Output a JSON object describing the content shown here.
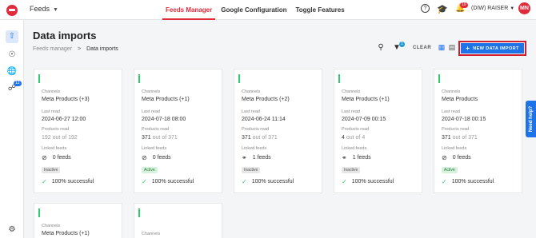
{
  "topbar": {
    "app_label": "Feeds",
    "tabs": [
      "Feeds Manager",
      "Google Configuration",
      "Toggle Features"
    ],
    "active_tab_index": 0,
    "notification_count": "10",
    "account_label": "(DIW) RAISER",
    "avatar_initials": "MN"
  },
  "sidebar": {
    "items": [
      "upload-icon",
      "radar-icon",
      "globe-icon",
      "shield-icon",
      "settings-icon"
    ],
    "badge": "12"
  },
  "page": {
    "title": "Data imports",
    "breadcrumb": {
      "parent": "Feeds manager",
      "separator": ">",
      "current": "Data imports"
    }
  },
  "toolbar": {
    "filter_count": "1",
    "clear_label": "CLEAR",
    "new_button_label": "NEW DATA IMPORT"
  },
  "labels": {
    "channels": "Channels",
    "last_read": "Last read",
    "products_read": "Products read",
    "linked_feeds": "Linked feeds"
  },
  "cards": [
    {
      "channels": "Meta Products (+3)",
      "last_read": "2024-06-27 12:00",
      "products_read": "192",
      "products_total": "out of 192",
      "linked_feeds": "0 feeds",
      "status": "Inactive",
      "success": "100% successful"
    },
    {
      "channels": "Meta Products (+1)",
      "last_read": "2024-07-18 08:00",
      "products_read": "371",
      "products_total": "out of 371",
      "linked_feeds": "0 feeds",
      "status": "Active",
      "success": "100% successful"
    },
    {
      "channels": "Meta Products (+2)",
      "last_read": "2024-06-24 11:14",
      "products_read": "371",
      "products_total": "out of 371",
      "linked_feeds": "1 feeds",
      "status": "Inactive",
      "success": "100% successful"
    },
    {
      "channels": "Meta Products (+1)",
      "last_read": "2024-07-09 00:15",
      "products_read": "4",
      "products_total": "out of 4",
      "linked_feeds": "1 feeds",
      "status": "Inactive",
      "success": "100% successful"
    },
    {
      "channels": "Meta Products",
      "last_read": "2024-07-18 00:15",
      "products_read": "371",
      "products_total": "out of 371",
      "linked_feeds": "0 feeds",
      "status": "Active",
      "success": "100% successful"
    },
    {
      "channels": "Meta Products (+1)"
    },
    {
      "channels": ""
    }
  ],
  "help_tab": "Need help?",
  "colors": {
    "brand_red": "#e02b3a",
    "primary_blue": "#1e73e8",
    "success_green": "#2ecc71"
  }
}
